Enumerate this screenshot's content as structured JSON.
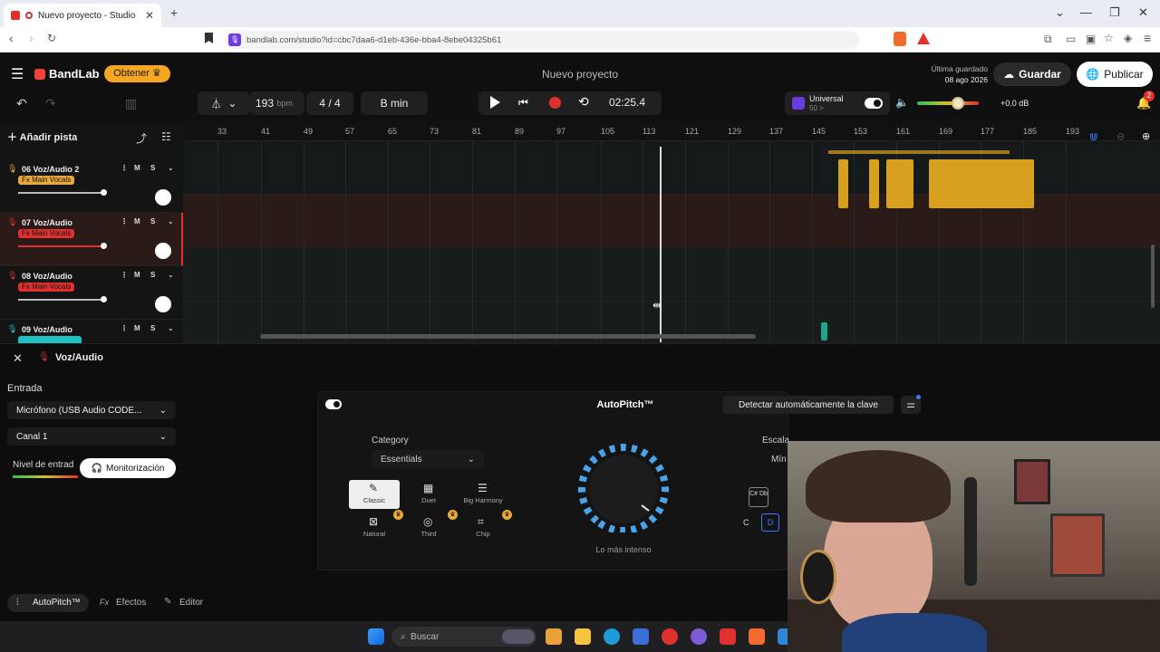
{
  "browser": {
    "tab_title": "Nuevo proyecto - Studio",
    "url": "bandlab.com/studio?id=cbc7daa6-d1eb-436e-bba4-8ebe04325b61"
  },
  "header": {
    "logo": "BandLab",
    "obtener": "Obtener",
    "project_title": "Nuevo proyecto",
    "last_saved_label": "Última guardado",
    "last_saved_date": "08 ago 2026",
    "save": "Guardar",
    "publish": "Publicar",
    "notifications": "2"
  },
  "toolbar": {
    "bpm_value": "193",
    "bpm_unit": "bpm",
    "time_sig": "4 / 4",
    "key": "B min",
    "timecode": "02:25.4",
    "universal_title": "Universal",
    "universal_sub": "50 >",
    "master_db": "+0.0 dB"
  },
  "timeline": {
    "add_track": "Añadir pista",
    "ruler": [
      "33",
      "41",
      "49",
      "57",
      "65",
      "73",
      "81",
      "89",
      "97",
      "105",
      "113",
      "121",
      "129",
      "137",
      "145",
      "153",
      "161",
      "169",
      "177",
      "185",
      "193"
    ],
    "tracks": [
      {
        "name": "06 Voz/Audio 2",
        "fx": "Fx Main Vocals",
        "fx_color": "#e8a93a"
      },
      {
        "name": "07 Voz/Audio",
        "fx": "Fx Main Vocals",
        "fx_color": "#e0312f"
      },
      {
        "name": "08 Voz/Audio",
        "fx": "Fx Main Vocals",
        "fx_color": "#e0312f"
      },
      {
        "name": "09 Voz/Audio",
        "fx": "",
        "fx_color": "#1fc0c0"
      }
    ],
    "mute": "M",
    "solo": "S"
  },
  "panel": {
    "track_name": "Voz/Audio",
    "input_label": "Entrada",
    "input_device": "Micrófono (USB Audio CODE...",
    "channel": "Canal 1",
    "input_level_label": "Nivel de entrad",
    "monitoring": "Monitorización",
    "autopitch_title": "AutoPitch™",
    "detect_key": "Detectar automáticamente la clave",
    "category_label": "Category",
    "category_value": "Essentials",
    "presets": [
      {
        "name": "Classic",
        "icon": "wand-icon"
      },
      {
        "name": "Duet",
        "icon": "grid-icon"
      },
      {
        "name": "Big Harmony",
        "icon": "layers-icon"
      },
      {
        "name": "Natural",
        "icon": "pattern-icon"
      },
      {
        "name": "Third",
        "icon": "globe-icon"
      },
      {
        "name": "Chip",
        "icon": "chip-icon"
      }
    ],
    "dial_label": "Lo más intenso",
    "scale_label": "Escala",
    "scale_value": "Mín",
    "key_c": "C",
    "key_d": "D",
    "key_cdb": "C# Db"
  },
  "bottom_tabs": [
    {
      "label": "AutoPitch™"
    },
    {
      "label": "Efectos"
    },
    {
      "label": "Editor"
    }
  ],
  "taskbar": {
    "search": "Buscar"
  }
}
